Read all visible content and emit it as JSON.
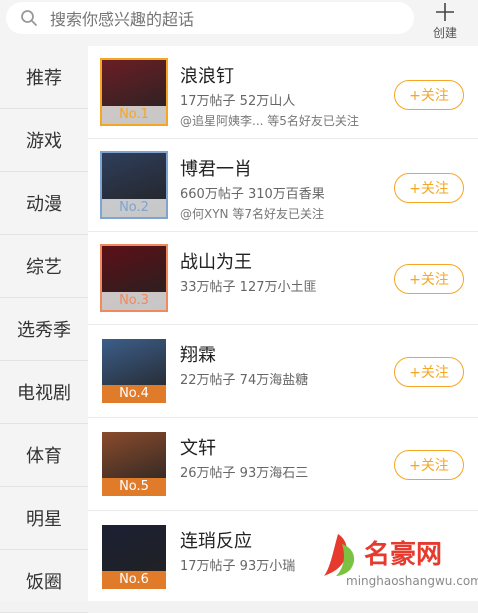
{
  "search": {
    "placeholder": "搜索你感兴趣的超话"
  },
  "header": {
    "create_label": "创建"
  },
  "sidebar": {
    "items": [
      {
        "label": "推荐",
        "active": false
      },
      {
        "label": "游戏",
        "active": false
      },
      {
        "label": "动漫",
        "active": false
      },
      {
        "label": "综艺",
        "active": false
      },
      {
        "label": "选秀季",
        "active": false
      },
      {
        "label": "电视剧",
        "active": false
      },
      {
        "label": "体育",
        "active": false
      },
      {
        "label": "明星",
        "active": false
      },
      {
        "label": "饭圈",
        "active": false
      }
    ]
  },
  "list": {
    "follow_label": "+关注",
    "items": [
      {
        "rank": "No.1",
        "name": "浪浪钉",
        "stats": "17万帖子 52万山人",
        "friends": "@追星阿姨李... 等5名好友已关注",
        "rank_color": "#f5a623",
        "thumb_color": "#6b1e25"
      },
      {
        "rank": "No.2",
        "name": "博君一肖",
        "stats": "660万帖子 310万百香果",
        "friends": "@何XYN 等7名好友已关注",
        "rank_color": "#7fa4cf",
        "thumb_color": "#2f3e5c"
      },
      {
        "rank": "No.3",
        "name": "战山为王",
        "stats": "33万帖子 127万小土匪",
        "friends": "",
        "rank_color": "#f08a5d",
        "thumb_color": "#5c1016"
      },
      {
        "rank": "No.4",
        "name": "翔霖",
        "stats": "22万帖子 74万海盐糖",
        "friends": "",
        "rank_color": "#e07b2a",
        "thumb_color": "#3c5e8a"
      },
      {
        "rank": "No.5",
        "name": "文轩",
        "stats": "26万帖子 93万海石三",
        "friends": "",
        "rank_color": "#e07b2a",
        "thumb_color": "#8a4b2c"
      },
      {
        "rank": "No.6",
        "name": "连琑反应",
        "stats": "17万帖子 93万小瑞",
        "friends": "",
        "rank_color": "#e07b2a",
        "thumb_color": "#1b2033"
      }
    ]
  },
  "watermark": {
    "text": "名豪网",
    "url": "minghaoshangwu.com"
  },
  "colors": {
    "accent": "#f5a623",
    "watermark_red": "#e63a2e"
  }
}
